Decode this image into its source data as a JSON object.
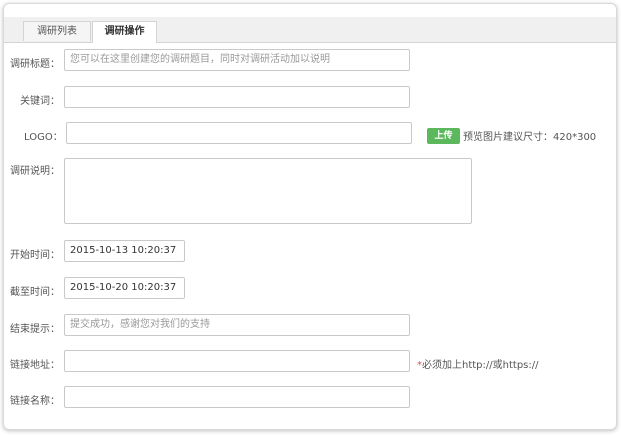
{
  "tabs": [
    {
      "label": "调研列表",
      "active": false
    },
    {
      "label": "调研操作",
      "active": true
    }
  ],
  "form": {
    "title": {
      "label": "调研标题：",
      "placeholder": "您可以在这里创建您的调研题目，同时对调研活动加以说明"
    },
    "keywords": {
      "label": "关键词：",
      "value": ""
    },
    "logo": {
      "label": "LOGO：",
      "upload_button": "上传",
      "hint": "预览图片建议尺寸：420*300"
    },
    "description": {
      "label": "调研说明：",
      "value": ""
    },
    "start_time": {
      "label": "开始时间：",
      "value": "2015-10-13 10:20:37"
    },
    "end_time": {
      "label": "截至时间：",
      "value": "2015-10-20 10:20:37"
    },
    "end_message": {
      "label": "结束提示：",
      "placeholder": "提交成功，感谢您对我们的支持"
    },
    "link_url": {
      "label": "链接地址：",
      "required_mark": "*",
      "hint": "必须加上http://或https://"
    },
    "link_name": {
      "label": "链接名称：",
      "value": ""
    }
  },
  "colors": {
    "upload_button": "#5cb85c",
    "required": "#d9534f"
  }
}
